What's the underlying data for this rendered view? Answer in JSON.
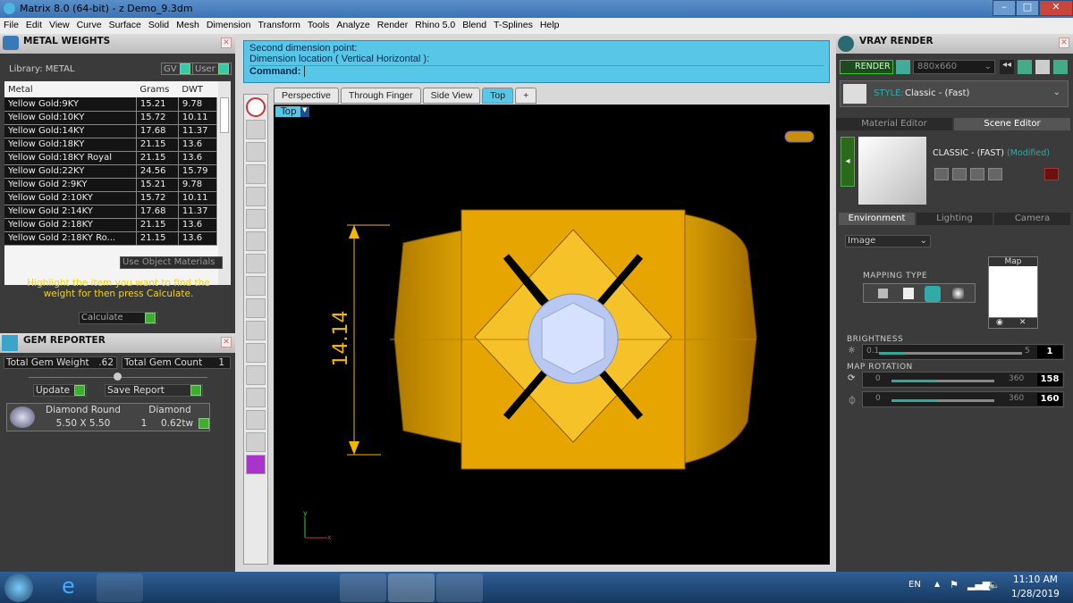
{
  "window": {
    "title": "Matrix 8.0 (64-bit) - z Demo_9.3dm"
  },
  "menu": [
    "File",
    "Edit",
    "View",
    "Curve",
    "Surface",
    "Solid",
    "Mesh",
    "Dimension",
    "Transform",
    "Tools",
    "Analyze",
    "Render",
    "Rhino 5.0",
    "Blend",
    "T-Splines",
    "Help"
  ],
  "metal_weights": {
    "title": "METAL WEIGHTS",
    "library": "Library: METAL",
    "gv": "GV",
    "user": "User",
    "columns": [
      "Metal",
      "Grams",
      "DWT"
    ],
    "rows": [
      [
        "Yellow Gold:9KY",
        "15.21",
        "9.78"
      ],
      [
        "Yellow Gold:10KY",
        "15.72",
        "10.11"
      ],
      [
        "Yellow Gold:14KY",
        "17.68",
        "11.37"
      ],
      [
        "Yellow Gold:18KY",
        "21.15",
        "13.6"
      ],
      [
        "Yellow Gold:18KY Royal",
        "21.15",
        "13.6"
      ],
      [
        "Yellow Gold:22KY",
        "24.56",
        "15.79"
      ],
      [
        "Yellow Gold 2:9KY",
        "15.21",
        "9.78"
      ],
      [
        "Yellow Gold 2:10KY",
        "15.72",
        "10.11"
      ],
      [
        "Yellow Gold 2:14KY",
        "17.68",
        "11.37"
      ],
      [
        "Yellow Gold 2:18KY",
        "21.15",
        "13.6"
      ],
      [
        "Yellow Gold 2:18KY Ro...",
        "21.15",
        "13.6"
      ]
    ],
    "use_object_materials": "Use Object Materials",
    "hint": "Highlight the item you want to find the weight for then press Calculate.",
    "calculate": "Calculate"
  },
  "gem_reporter": {
    "title": "GEM REPORTER",
    "total_weight_label": "Total Gem Weight",
    "total_weight": ".62",
    "total_count_label": "Total Gem Count",
    "total_count": "1",
    "update": "Update",
    "save_report": "Save Report",
    "gem": {
      "shape": "Diamond Round",
      "size": "5.50 X 5.50",
      "material": "Diamond",
      "count": "1",
      "weight": "0.62tw"
    }
  },
  "command": {
    "line1": "Second dimension point:",
    "line2": "Dimension location ( Vertical  Horizontal ):",
    "prompt": "Command:"
  },
  "viewport_tabs": [
    "Perspective",
    "Through Finger",
    "Side View",
    "Top"
  ],
  "active_tab": "Top",
  "viewport": {
    "label": "Top",
    "dimension": "14.14",
    "axis_x": "x",
    "axis_y": "y"
  },
  "vray": {
    "title": "VRAY RENDER",
    "render": "RENDER",
    "resolution": "880x660",
    "style_label": "STYLE:",
    "style": "Classic - (Fast)",
    "tabs": [
      "Material Editor",
      "Scene Editor"
    ],
    "active_tab": "Scene Editor",
    "scene_name": "CLASSIC - (FAST)",
    "modified": "(Modified)",
    "subtabs": [
      "Environment",
      "Lighting",
      "Camera"
    ],
    "active_subtab": "Environment",
    "env_type": "Image",
    "mapping_type": "MAPPING TYPE",
    "map": "Map",
    "brightness": {
      "label": "BRIGHTNESS",
      "min": "0.1",
      "max": "5",
      "value": "1"
    },
    "map_rotation": {
      "label": "MAP ROTATION",
      "r1": {
        "min": "0",
        "max": "360",
        "value": "158"
      },
      "r2": {
        "min": "0",
        "max": "360",
        "value": "160"
      }
    }
  },
  "taskbar": {
    "lang": "EN",
    "time": "11:10 AM",
    "date": "1/28/2019"
  },
  "colors": {
    "accent": "#58c6e6",
    "gold": "#f2b705",
    "green": "#3fae2f"
  }
}
